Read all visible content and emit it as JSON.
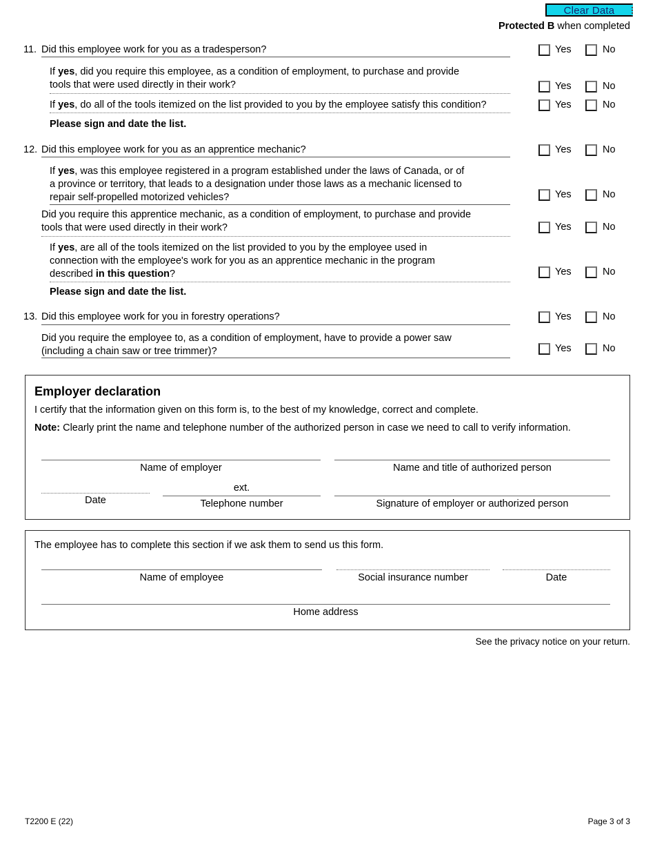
{
  "header": {
    "clear_data_label": "Clear Data",
    "protected_bold": "Protected B",
    "protected_rest": " when completed"
  },
  "questions": [
    {
      "number": "11.",
      "text": "Did this employee work for you as a tradesperson?",
      "yes_label": "Yes",
      "no_label": "No"
    },
    {
      "line1_a": "If ",
      "line1_b": "yes",
      "line1_c": ", did you require this employee, as a condition of employment, to purchase and provide",
      "line2": "tools that were used directly in their work?",
      "yes_label": "Yes",
      "no_label": "No"
    },
    {
      "line1_a": "If ",
      "line1_b": "yes",
      "line1_c": ", do all of the tools itemized on the list provided to you by the employee satisfy this condition?",
      "yes_label": "Yes",
      "no_label": "No"
    },
    {
      "signdate": "Please sign and date the list."
    },
    {
      "number": "12.",
      "text": "Did this employee work for you as an apprentice mechanic?",
      "yes_label": "Yes",
      "no_label": "No"
    },
    {
      "line1_a": "If ",
      "line1_b": "yes",
      "line1_c": ", was this employee registered in a program established under the laws of Canada, or of",
      "line2": "a province or territory, that leads to a designation under those laws as a mechanic licensed to",
      "line3": "repair self-propelled motorized vehicles?",
      "yes_label": "Yes",
      "no_label": "No"
    },
    {
      "line1": "Did you require this apprentice mechanic, as a condition of employment, to purchase and provide",
      "line2": "tools that were used directly in their work?",
      "yes_label": "Yes",
      "no_label": "No"
    },
    {
      "line1_a": "If ",
      "line1_b": "yes",
      "line1_c": ", are all of the tools itemized on the list provided to you by the employee used in",
      "line2": "connection with the employee's work for you as an apprentice mechanic in the program",
      "line3_a": "described ",
      "line3_b": "in this question",
      "line3_c": "?",
      "yes_label": "Yes",
      "no_label": "No"
    },
    {
      "signdate": "Please sign and date the list."
    },
    {
      "number": "13.",
      "text": "Did this employee work for you in forestry operations?",
      "yes_label": "Yes",
      "no_label": "No"
    },
    {
      "line1": "Did you require the employee to, as a condition of employment, have to provide a power saw",
      "line2": "(including a chain saw or tree trimmer)?",
      "yes_label": "Yes",
      "no_label": "No"
    }
  ],
  "employer_declaration": {
    "title": "Employer declaration",
    "certify": "I certify that the information given on this form is, to the best of my knowledge, correct and complete.",
    "note_bold": "Note:",
    "note_rest": " Clearly print the name and telephone number of the authorized person in case we need to call to verify information.",
    "name_of_employer": "Name of employer",
    "name_title_authorized": "Name and title of authorized person",
    "date": "Date",
    "ext": "ext.",
    "telephone_number": "Telephone number",
    "signature": "Signature of employer or authorized person"
  },
  "employee_section": {
    "intro": "The employee has to complete this section if we ask them to send us this form.",
    "name_of_employee": "Name of employee",
    "social_insurance_number": "Social insurance number",
    "date": "Date",
    "home_address": "Home address"
  },
  "footer": {
    "privacy": "See the privacy notice on your return.",
    "form_code": "T2200 E (22)",
    "page": "Page 3 of 3"
  }
}
